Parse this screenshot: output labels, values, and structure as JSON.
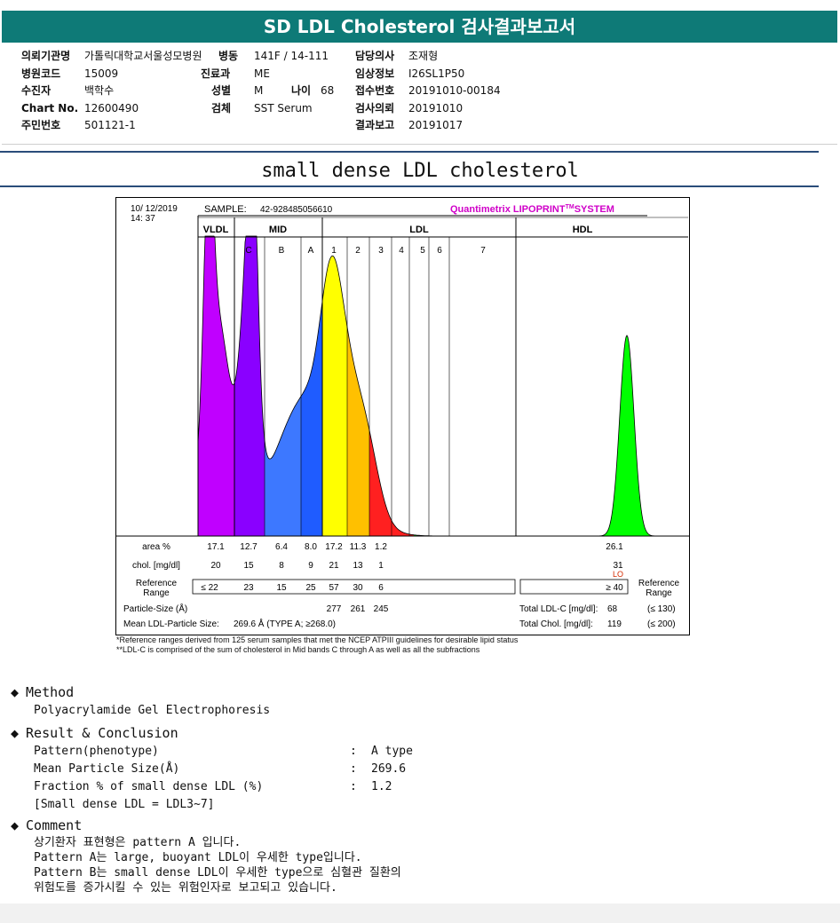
{
  "report": {
    "title": "SD LDL Cholesterol 검사결과보고서",
    "fields": {
      "institution_label": "의뢰기관명",
      "institution_value": "가톨릭대학교서울성모병원",
      "ward_label": "병동",
      "ward_value": "141F / 14-111",
      "doctor_label": "담당의사",
      "doctor_value": "조재형",
      "hospital_code_label": "병원코드",
      "hospital_code_value": "15009",
      "department_label": "진료과",
      "department_value": "ME",
      "clinical_info_label": "임상정보",
      "clinical_info_value": "I26SL1P50",
      "patient_label": "수진자",
      "patient_value": "백학수",
      "sex_label": "성별",
      "sex_value": "M",
      "age_label": "나이",
      "age_value": "68",
      "receipt_label": "접수번호",
      "receipt_value": "20191010-00184",
      "chart_no_label": "Chart No.",
      "chart_no_value": "12600490",
      "specimen_label": "검체",
      "specimen_value": "SST Serum",
      "request_label": "검사의뢰",
      "request_value": "20191010",
      "rrn_label": "주민번호",
      "rrn_value": "501121-1",
      "report_label": "결과보고",
      "report_value": "20191017"
    }
  },
  "section_title": "small dense LDL cholesterol",
  "chart_data": {
    "type": "area",
    "date": "10/ 12/2019",
    "time": "14: 37",
    "sample_label": "SAMPLE:",
    "sample_id": "42-928485056610",
    "system_text": "Quantimetrix LIPOPRINT",
    "system_sup": "TM",
    "system_tail": "SYSTEM",
    "groups": [
      "VLDL",
      "MID",
      "LDL",
      "HDL"
    ],
    "bands": [
      "C",
      "B",
      "A",
      "1",
      "2",
      "3",
      "4",
      "5",
      "6",
      "7"
    ],
    "segments": [
      {
        "name": "VLDL",
        "color": "#c000ff"
      },
      {
        "name": "MID C",
        "color": "#8a00ff"
      },
      {
        "name": "MID B",
        "color": "#3d78ff"
      },
      {
        "name": "MID A",
        "color": "#1f5cff"
      },
      {
        "name": "LDL 1",
        "color": "#ffff00"
      },
      {
        "name": "LDL 2",
        "color": "#ffc000"
      },
      {
        "name": "LDL 3",
        "color": "#ff2020"
      },
      {
        "name": "HDL",
        "color": "#00ff00"
      }
    ],
    "row_labels": {
      "area": "area %",
      "chol": "chol. [mg/dl]",
      "ref1": "Reference",
      "ref2": "Range",
      "particle": "Particle-Size (Å)",
      "mean": "Mean LDL-Particle Size:",
      "ref_right1": "Reference",
      "ref_right2": "Range"
    },
    "area_pct": [
      "17.1",
      "12.7",
      "6.4",
      "8.0",
      "17.2",
      "11.3",
      "1.2"
    ],
    "hdl_area_pct": "26.1",
    "chol": [
      "20",
      "15",
      "8",
      "9",
      "21",
      "13",
      "1"
    ],
    "hdl_chol": "31",
    "hdl_flag": "LO",
    "ref_first": "≤ 22",
    "ref_range": [
      "23",
      "15",
      "25",
      "57",
      "30",
      "6"
    ],
    "hdl_ref": "≥ 40",
    "particle_sizes": [
      "277",
      "261",
      "245"
    ],
    "mean_size_text": "269.6 Å   (TYPE A; ≥268.0)",
    "total_ldl_label": "Total LDL-C [mg/dl]:",
    "total_ldl_value": "68",
    "total_ldl_ref": "(≤ 130)",
    "total_chol_label": "Total Chol. [mg/dl]:",
    "total_chol_value": "119",
    "total_chol_ref": "(≤ 200)"
  },
  "notes": {
    "n1": "*Reference ranges derived from 125 serum samples that met the NCEP ATPIII guidelines for desirable lipid status",
    "n2": "**LDL-C is comprised of the sum of cholesterol in Mid bands C through A as well as all the subfractions"
  },
  "method": {
    "heading": "Method",
    "text": "Polyacrylamide Gel Electrophoresis"
  },
  "result": {
    "heading": "Result & Conclusion",
    "rows": [
      {
        "label": "Pattern(phenotype)",
        "value": "A type"
      },
      {
        "label": "Mean Particle Size(Å)",
        "value": "269.6"
      },
      {
        "label": "Fraction % of small dense LDL (%)",
        "value": "1.2"
      }
    ],
    "note": "[Small dense LDL = LDL3~7]",
    "colon": ":"
  },
  "comment": {
    "heading": "Comment",
    "lines": [
      "상기환자 표현형은 pattern A 입니다.",
      "Pattern A는 large, buoyant LDL이 우세한 type입니다.",
      "Pattern B는 small dense LDL이 우세한 type으로 심혈관 질환의",
      "위험도를 증가시킬 수 있는 위험인자로 보고되고 있습니다."
    ]
  },
  "colors": {
    "header": "#0e7a77",
    "rule": "#2a4d7a",
    "system_text": "#d000c8",
    "flag": "#d42a00"
  }
}
